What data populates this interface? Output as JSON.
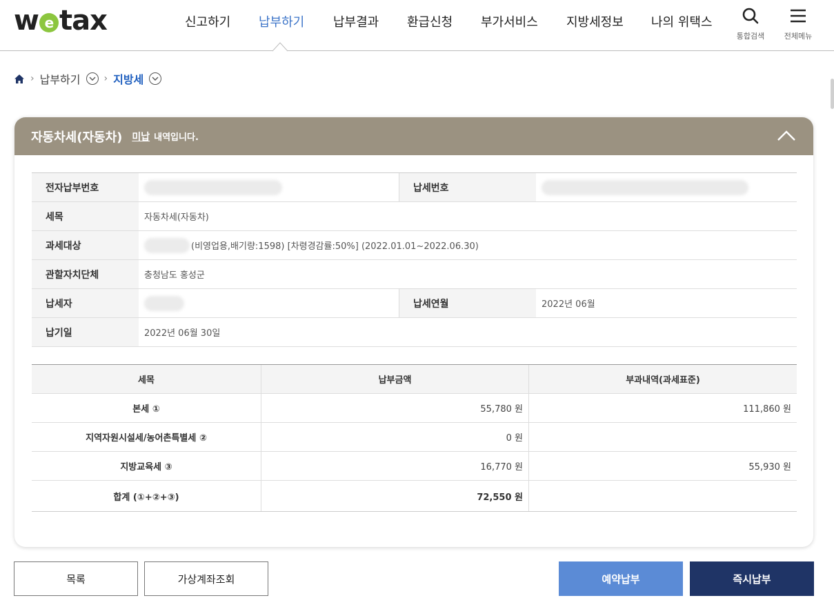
{
  "header": {
    "logo_left": "w",
    "logo_e": "e",
    "logo_right": "tax",
    "nav": [
      {
        "label": "신고하기",
        "active": false
      },
      {
        "label": "납부하기",
        "active": true
      },
      {
        "label": "납부결과",
        "active": false
      },
      {
        "label": "환급신청",
        "active": false
      },
      {
        "label": "부가서비스",
        "active": false
      },
      {
        "label": "지방세정보",
        "active": false
      },
      {
        "label": "나의 위택스",
        "active": false
      }
    ],
    "search_label": "통합검색",
    "menu_label": "전체메뉴"
  },
  "breadcrumb": {
    "level1": "납부하기",
    "level2": "지방세"
  },
  "card": {
    "title": "자동차세(자동차)",
    "status": "미납",
    "suffix": "내역입니다."
  },
  "info": {
    "rows": [
      {
        "label": "전자납부번호",
        "value": "",
        "label2": "납세번호",
        "value2": ""
      },
      {
        "label": "세목",
        "value": "자동차세(자동차)"
      },
      {
        "label": "과세대상",
        "value": "(비영업용,배기량:1598) [차령경감률:50%]  (2022.01.01~2022.06.30)"
      },
      {
        "label": "관할자치단체",
        "value": "충청남도 홍성군"
      },
      {
        "label": "납세자",
        "value": "",
        "label2": "납세연월",
        "value2": "2022년 06월"
      },
      {
        "label": "납기일",
        "value": "2022년 06월 30일"
      }
    ]
  },
  "amounts": {
    "headers": [
      "세목",
      "납부금액",
      "부과내역(과세표준)"
    ],
    "rows": [
      {
        "item": "본세 ①",
        "amount": "55,780 원",
        "base": "111,860 원"
      },
      {
        "item": "지역자원시설세/농어촌특별세 ②",
        "amount": "0 원",
        "base": ""
      },
      {
        "item": "지방교육세 ③",
        "amount": "16,770 원",
        "base": "55,930 원"
      }
    ],
    "total": {
      "item": "합계 (①+②+③)",
      "amount": "72,550 원",
      "base": ""
    }
  },
  "buttons": {
    "list": "목록",
    "virtual_account": "가상계좌조회",
    "reserve_pay": "예약납부",
    "pay_now": "즉시납부"
  },
  "colors": {
    "card_header": "#9b9281",
    "active_nav": "#3c74c8",
    "reserve_button": "#5b8bd6",
    "pay_button": "#1f3466",
    "logo_e": "#8cc63f"
  }
}
